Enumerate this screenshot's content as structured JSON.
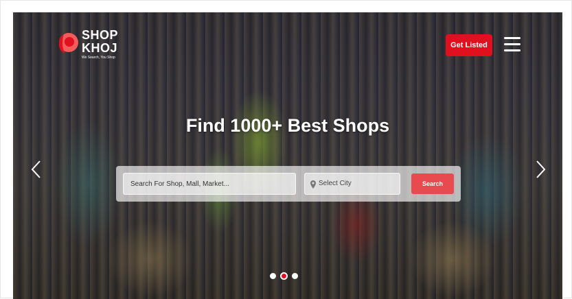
{
  "brand": {
    "line1": "SHOP",
    "line2": "KHOJ",
    "tagline": "We Search, You Shop",
    "accent_color": "#e0101e"
  },
  "header": {
    "cta_label": "Get Listed",
    "menu_icon": "hamburger-icon"
  },
  "hero": {
    "headline": "Find 1000+ Best Shops"
  },
  "search": {
    "shop_placeholder": "Search For Shop, Mall, Market...",
    "city_label": "Select City",
    "city_icon": "map-pin-icon",
    "button_label": "Search",
    "button_color": "#e74b50"
  },
  "carousel": {
    "prev_icon": "chevron-left-icon",
    "next_icon": "chevron-right-icon",
    "slide_count": 3,
    "active_slide": 2
  }
}
